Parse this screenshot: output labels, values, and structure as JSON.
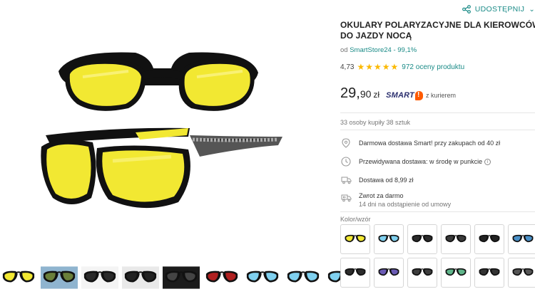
{
  "header": {
    "share_label": "UDOSTĘPNIJ",
    "share_icon": "share-icon"
  },
  "product": {
    "title": "OKULARY POLARYZACYJNE DLA KIEROWCÓW DO JAZDY NOCĄ",
    "seller_prefix": "od",
    "seller_name": "SmartStore24 - 99,1%",
    "rating": "4,73",
    "rating_stars": 5,
    "rating_count": "972 oceny produktu",
    "price_int": "29,",
    "price_dec": "90",
    "price_currency": "zł",
    "smart_label": "SMART",
    "courier_label": "z kurierem",
    "bought": "33 osoby kupiły 38 sztuk"
  },
  "delivery": {
    "free": "Darmowa dostawa Smart! przy zakupach od 40 zł",
    "expected": "Przewidywana dostawa: w środę w punkcie",
    "from": "Dostawa od 8,99 zł",
    "returns": "Zwrot za darmo",
    "returns_sub": "14 dni na odstąpienie od umowy"
  },
  "variants": {
    "label": "Kolor/wzór",
    "count": 12
  },
  "gallery": {
    "thumb_count": 9
  },
  "colors": {
    "accent": "#1a8b87",
    "star": "#fbb900",
    "smart": "#2b2f6e",
    "smart_badge": "#ff5a00",
    "lens_yellow": "#f2e832",
    "frame": "#111111"
  }
}
